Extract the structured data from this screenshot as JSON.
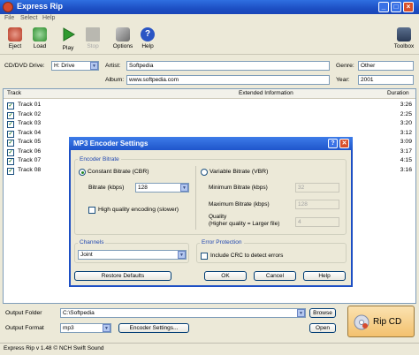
{
  "window": {
    "title": "Express Rip"
  },
  "menu": [
    "File",
    "Select",
    "Help"
  ],
  "toolbar": {
    "eject": "Eject",
    "load": "Load",
    "play": "Play",
    "stop": "Stop",
    "options": "Options",
    "help": "Help",
    "toolbox": "Toolbox"
  },
  "disc": {
    "drive_label": "CD/DVD Drive:",
    "drive_value": "H: Drive",
    "artist_label": "Artist:",
    "artist_value": "Softpedia",
    "genre_label": "Genre:",
    "genre_value": "Other",
    "album_label": "Album:",
    "album_value": "www.softpedia.com",
    "year_label": "Year:",
    "year_value": "2001"
  },
  "tracks": {
    "col_track": "Track",
    "col_info": "Extended Information",
    "col_duration": "Duration",
    "rows": [
      {
        "name": "Track 01",
        "duration": "3:26"
      },
      {
        "name": "Track 02",
        "duration": "2:25"
      },
      {
        "name": "Track 03",
        "duration": "3:20"
      },
      {
        "name": "Track 04",
        "duration": "3:12"
      },
      {
        "name": "Track 05",
        "duration": "3:09"
      },
      {
        "name": "Track 06",
        "duration": "3:17"
      },
      {
        "name": "Track 07",
        "duration": "4:15"
      },
      {
        "name": "Track 08",
        "duration": "3:16"
      }
    ]
  },
  "dialog": {
    "title": "MP3 Encoder Settings",
    "help_glyph": "?",
    "close_glyph": "✕",
    "bitrate_group": "Encoder Bitrate",
    "cbr_label": "Constant Bitrate (CBR)",
    "bitrate_label": "Bitrate (kbps)",
    "bitrate_value": "128",
    "hq_label": "High quality encoding (slower)",
    "vbr_label": "Variable Bitrate (VBR)",
    "min_label": "Minimum Bitrate (kbps)",
    "min_value": "32",
    "max_label": "Maximum Bitrate (kbps)",
    "max_value": "128",
    "quality_label": "Quality",
    "quality_note": "(Higher quality = Larger file)",
    "quality_value": "4",
    "channels_group": "Channels",
    "channels_value": "Joint",
    "error_group": "Error Protection",
    "crc_label": "Include CRC to detect errors",
    "restore_btn": "Restore Defaults",
    "ok_btn": "OK",
    "cancel_btn": "Cancel",
    "help_btn": "Help"
  },
  "output": {
    "folder_label": "Output Folder",
    "folder_value": "C:\\Softpedia",
    "browse_btn": "Browse",
    "format_label": "Output Format",
    "format_value": "mp3",
    "encoder_btn": "Encoder Settings...",
    "open_btn": "Open",
    "rip_btn": "Rip CD"
  },
  "status": "Express Rip v 1.48 © NCH Swift Sound",
  "colors": {
    "titlebar": "#1d4fc4",
    "close": "#d8502b",
    "accent": "#3a72e6"
  }
}
